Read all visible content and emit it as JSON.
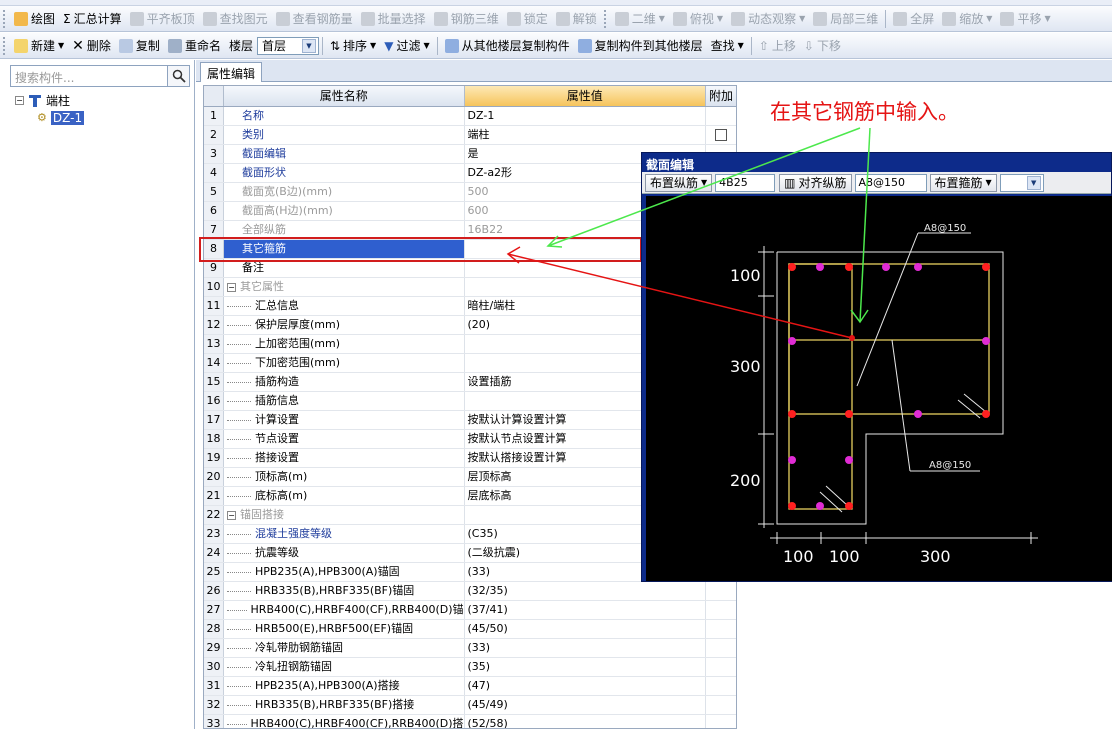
{
  "toolbar1": {
    "draw": "绘图",
    "summary": "汇总计算",
    "flush_board": "平齐板顶",
    "find_element": "查找图元",
    "view_rebar_qty": "查看钢筋量",
    "batch_select": "批量选择",
    "rebar_3d": "钢筋三维",
    "lock": "锁定",
    "unlock": "解锁",
    "view_2d": "二维",
    "top_view": "俯视",
    "dynamic_view": "动态观察",
    "local_3d": "局部三维",
    "fullscreen": "全屏",
    "zoom": "缩放",
    "pan": "平移"
  },
  "toolbar2": {
    "new": "新建",
    "delete": "删除",
    "copy": "复制",
    "rename": "重命名",
    "floor_label": "楼层",
    "floor_value": "首层",
    "sort": "排序",
    "filter": "过滤",
    "copy_from_floor": "从其他楼层复制构件",
    "copy_to_floor": "复制构件到其他楼层",
    "find": "查找",
    "move_up": "上移",
    "move_down": "下移"
  },
  "left": {
    "search_placeholder": "搜索构件...",
    "tree_root": "端柱",
    "tree_child": "DZ-1"
  },
  "tab": {
    "label": "属性编辑"
  },
  "grid": {
    "headers": {
      "name": "属性名称",
      "value": "属性值",
      "extra": "附加"
    },
    "rows": [
      {
        "n": "1",
        "name": "名称",
        "value": "DZ-1"
      },
      {
        "n": "2",
        "name": "类别",
        "value": "端柱"
      },
      {
        "n": "3",
        "name": "截面编辑",
        "value": "是"
      },
      {
        "n": "4",
        "name": "截面形状",
        "value": "DZ-a2形"
      },
      {
        "n": "5",
        "name": "截面宽(B边)(mm)",
        "value": "500"
      },
      {
        "n": "6",
        "name": "截面高(H边)(mm)",
        "value": "600"
      },
      {
        "n": "7",
        "name": "全部纵筋",
        "value": "16B22"
      },
      {
        "n": "8",
        "name": "其它箍筋",
        "value": ""
      },
      {
        "n": "9",
        "name": "备注",
        "value": ""
      },
      {
        "n": "10",
        "name": "其它属性",
        "value": ""
      },
      {
        "n": "11",
        "name": "汇总信息",
        "value": "暗柱/端柱"
      },
      {
        "n": "12",
        "name": "保护层厚度(mm)",
        "value": "(20)"
      },
      {
        "n": "13",
        "name": "上加密范围(mm)",
        "value": ""
      },
      {
        "n": "14",
        "name": "下加密范围(mm)",
        "value": ""
      },
      {
        "n": "15",
        "name": "插筋构造",
        "value": "设置插筋"
      },
      {
        "n": "16",
        "name": "插筋信息",
        "value": ""
      },
      {
        "n": "17",
        "name": "计算设置",
        "value": "按默认计算设置计算"
      },
      {
        "n": "18",
        "name": "节点设置",
        "value": "按默认节点设置计算"
      },
      {
        "n": "19",
        "name": "搭接设置",
        "value": "按默认搭接设置计算"
      },
      {
        "n": "20",
        "name": "顶标高(m)",
        "value": "层顶标高"
      },
      {
        "n": "21",
        "name": "底标高(m)",
        "value": "层底标高"
      },
      {
        "n": "22",
        "name": "锚固搭接",
        "value": ""
      },
      {
        "n": "23",
        "name": "混凝土强度等级",
        "value": "(C35)"
      },
      {
        "n": "24",
        "name": "抗震等级",
        "value": "(二级抗震)"
      },
      {
        "n": "25",
        "name": "HPB235(A),HPB300(A)锚固",
        "value": "(33)"
      },
      {
        "n": "26",
        "name": "HRB335(B),HRBF335(BF)锚固",
        "value": "(32/35)"
      },
      {
        "n": "27",
        "name": "HRB400(C),HRBF400(CF),RRB400(D)锚",
        "value": "(37/41)"
      },
      {
        "n": "28",
        "name": "HRB500(E),HRBF500(EF)锚固",
        "value": "(45/50)"
      },
      {
        "n": "29",
        "name": "冷轧带肋钢筋锚固",
        "value": "(33)"
      },
      {
        "n": "30",
        "name": "冷轧扭钢筋锚固",
        "value": "(35)"
      },
      {
        "n": "31",
        "name": "HPB235(A),HPB300(A)搭接",
        "value": "(47)"
      },
      {
        "n": "32",
        "name": "HRB335(B),HRBF335(BF)搭接",
        "value": "(45/49)"
      },
      {
        "n": "33",
        "name": "HRB400(C),HRBF400(CF),RRB400(D)搭",
        "value": "(52/58)"
      }
    ]
  },
  "annotation": "在其它钢筋中输入。",
  "dialog": {
    "title": "截面编辑",
    "place_long_bar": "布置纵筋",
    "long_bar_value": "4B25",
    "align_long_bar": "对齐纵筋",
    "stirrup_value": "A8@150",
    "place_stirrup": "布置箍筋",
    "stirrup_label_top": "A8@150",
    "stirrup_label_bottom": "A8@150",
    "dim_100_v": "100",
    "dim_300_v": "300",
    "dim_200_v": "200",
    "dim_100_h1": "100",
    "dim_100_h2": "100",
    "dim_300_h": "300"
  },
  "colors": {
    "annotation_red": "#e51414",
    "arrow_green": "#4ce84c",
    "dialog_title_blue": "#0d2b8a",
    "rebar_red": "#ff2020",
    "rebar_magenta": "#e02cd4",
    "selected_blue": "#2f5fcf",
    "header_orange": "#f6c45c"
  }
}
